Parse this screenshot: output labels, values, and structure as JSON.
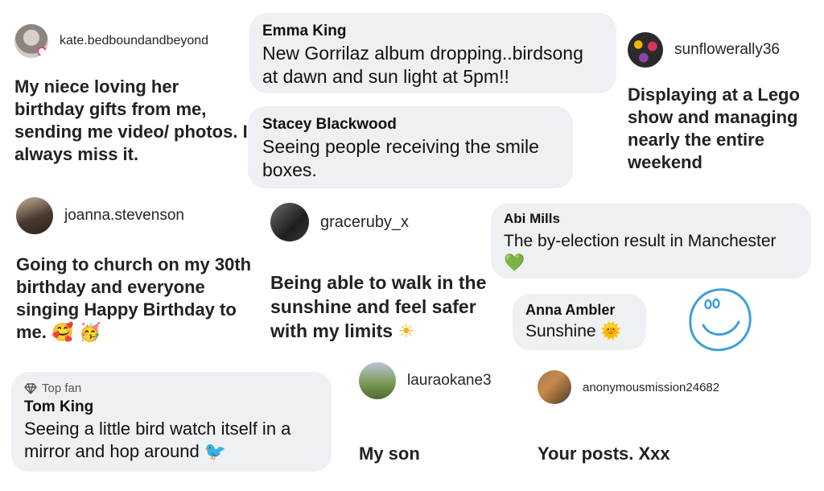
{
  "posts": {
    "kate": {
      "handle": "kate.bedboundandbeyond",
      "text": "My niece loving her birthday gifts from me, sending me video/ photos. I always miss it."
    },
    "sunflower": {
      "handle": "sunflowerally36",
      "text": "Displaying at a Lego show and managing nearly the entire weekend"
    },
    "joanna": {
      "handle": "joanna.stevenson",
      "text": "Going to church on my 30th birthday and everyone singing Happy Birthday to me.",
      "emoji": "🥰 🥳"
    },
    "grace": {
      "handle": "graceruby_x",
      "text": "Being able to walk in the sunshine and feel safer with my limits",
      "emoji": "☀"
    },
    "laura": {
      "handle": "lauraokane3",
      "text": "My son"
    },
    "anon": {
      "handle": "anonymousmission24682",
      "text": "Your posts.  Xxx"
    }
  },
  "comments": {
    "emma": {
      "name": "Emma King",
      "text": "New Gorrilaz album dropping..birdsong at dawn and sun light at 5pm!!"
    },
    "stacey": {
      "name": "Stacey Blackwood",
      "text": "Seeing people receiving the smile boxes."
    },
    "abi": {
      "name": "Abi Mills",
      "text": "The by-election result in Manchester",
      "emoji": "💚"
    },
    "anna": {
      "name": "Anna Ambler",
      "text": "Sunshine",
      "emoji": "🌞"
    },
    "tom": {
      "badge": "Top fan",
      "name": "Tom King",
      "text": "Seeing a little bird watch itself in a mirror and hop around",
      "emoji": "🐦"
    }
  },
  "colors": {
    "bubble": "#eef0f3",
    "doodle": "#3f9fd6",
    "verified": "#e0457b"
  }
}
